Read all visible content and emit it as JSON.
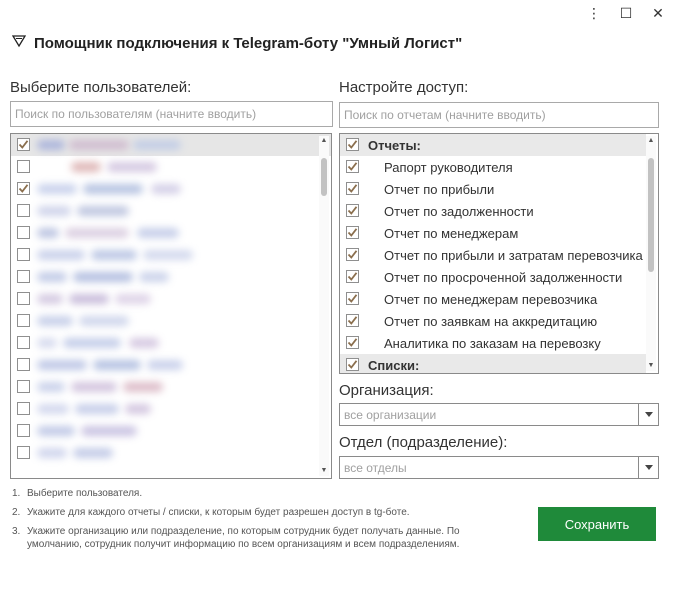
{
  "window": {
    "title": "Помощник подключения к Telegram-боту \"Умный Логист\"",
    "controls": {
      "menu": "⋮",
      "maximize": "☐",
      "close": "✕"
    }
  },
  "users": {
    "label": "Выберите пользователей:",
    "search_placeholder": "Поиск по пользователям (начните вводить)",
    "checked": [
      true,
      false,
      true,
      false,
      false,
      false,
      false,
      false,
      false,
      false,
      false,
      false,
      false,
      false,
      false
    ]
  },
  "access": {
    "label": "Настройте доступ:",
    "search_placeholder": "Поиск по отчетам (начните вводить)",
    "items": [
      {
        "label": "Отчеты:",
        "group": true
      },
      {
        "label": "Рапорт руководителя",
        "group": false
      },
      {
        "label": "Отчет по прибыли",
        "group": false
      },
      {
        "label": "Отчет по задолженности",
        "group": false
      },
      {
        "label": "Отчет по менеджерам",
        "group": false
      },
      {
        "label": "Отчет по прибыли и затратам перевозчика",
        "group": false
      },
      {
        "label": "Отчет по просроченной задолженности",
        "group": false
      },
      {
        "label": "Отчет по менеджерам перевозчика",
        "group": false
      },
      {
        "label": "Отчет по заявкам на аккредитацию",
        "group": false
      },
      {
        "label": "Аналитика по заказам на перевозку",
        "group": false
      },
      {
        "label": "Списки:",
        "group": true
      }
    ]
  },
  "organization": {
    "label": "Организация:",
    "value": "все организации"
  },
  "department": {
    "label": "Отдел (подразделение):",
    "value": "все отделы"
  },
  "instructions": [
    {
      "num": "1.",
      "text": "Выберите пользователя."
    },
    {
      "num": "2.",
      "text": "Укажите для каждого отчеты / списки, к которым будет разрешен доступ в tg-боте."
    },
    {
      "num": "3.",
      "text": "Укажите организацию или подразделение, по которым сотрудник будет получать данные. По умолчанию, сотрудник получит информацию по всем организациям и всем подразделениям."
    }
  ],
  "save_label": "Сохранить",
  "colors": {
    "accent": "#1f8a3a",
    "check": "#8b6f4e"
  }
}
